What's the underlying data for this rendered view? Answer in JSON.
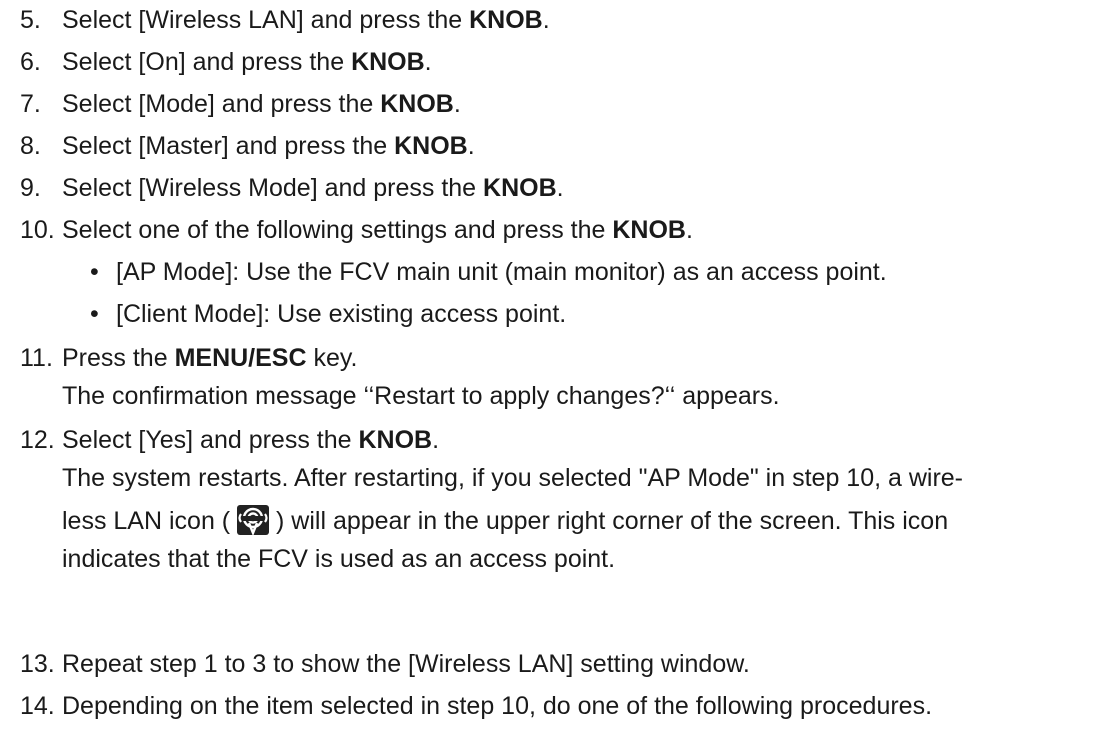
{
  "steps": [
    {
      "num": "5.",
      "pre": "Select [Wireless LAN] and press the ",
      "bold": "KNOB",
      "post": "."
    },
    {
      "num": "6.",
      "pre": "Select [On] and press the ",
      "bold": "KNOB",
      "post": "."
    },
    {
      "num": "7.",
      "pre": "Select [Mode] and press the ",
      "bold": "KNOB",
      "post": "."
    },
    {
      "num": "8.",
      "pre": "Select [Master] and press the ",
      "bold": "KNOB",
      "post": "."
    },
    {
      "num": "9.",
      "pre": "Select [Wireless Mode] and press the ",
      "bold": "KNOB",
      "post": "."
    },
    {
      "num": "10.",
      "pre": "Select one of the following settings and press the ",
      "bold": "KNOB",
      "post": "."
    },
    {
      "num": "11.",
      "pre": "Press the ",
      "bold": "MENU/ESC",
      "post": " key."
    },
    {
      "num": "12.",
      "pre": "Select [Yes] and press the ",
      "bold": "KNOB",
      "post": "."
    },
    {
      "num": "13.",
      "text": "Repeat step 1 to 3 to show the [Wireless LAN] setting window."
    },
    {
      "num": "14.",
      "text": "Depending on the item selected in step 10, do one of the following procedures."
    }
  ],
  "step10_bullets": [
    "[AP Mode]: Use the FCV main unit (main monitor) as an access point.",
    "[Client Mode]: Use existing access point."
  ],
  "bullet_char": "•",
  "step11_desc": "The confirmation message ‘‘Restart to apply changes?‘‘ appears.",
  "step12_desc": {
    "line1": "The system restarts. After restarting, if you selected \"AP Mode\" in step 10, a wire-",
    "line2_pre": "less LAN icon ( ",
    "line2_post": " ) will appear in the upper right corner of the screen. This icon",
    "line3": "indicates that the FCV is used as an access point."
  },
  "icon": "wireless-lan-icon"
}
